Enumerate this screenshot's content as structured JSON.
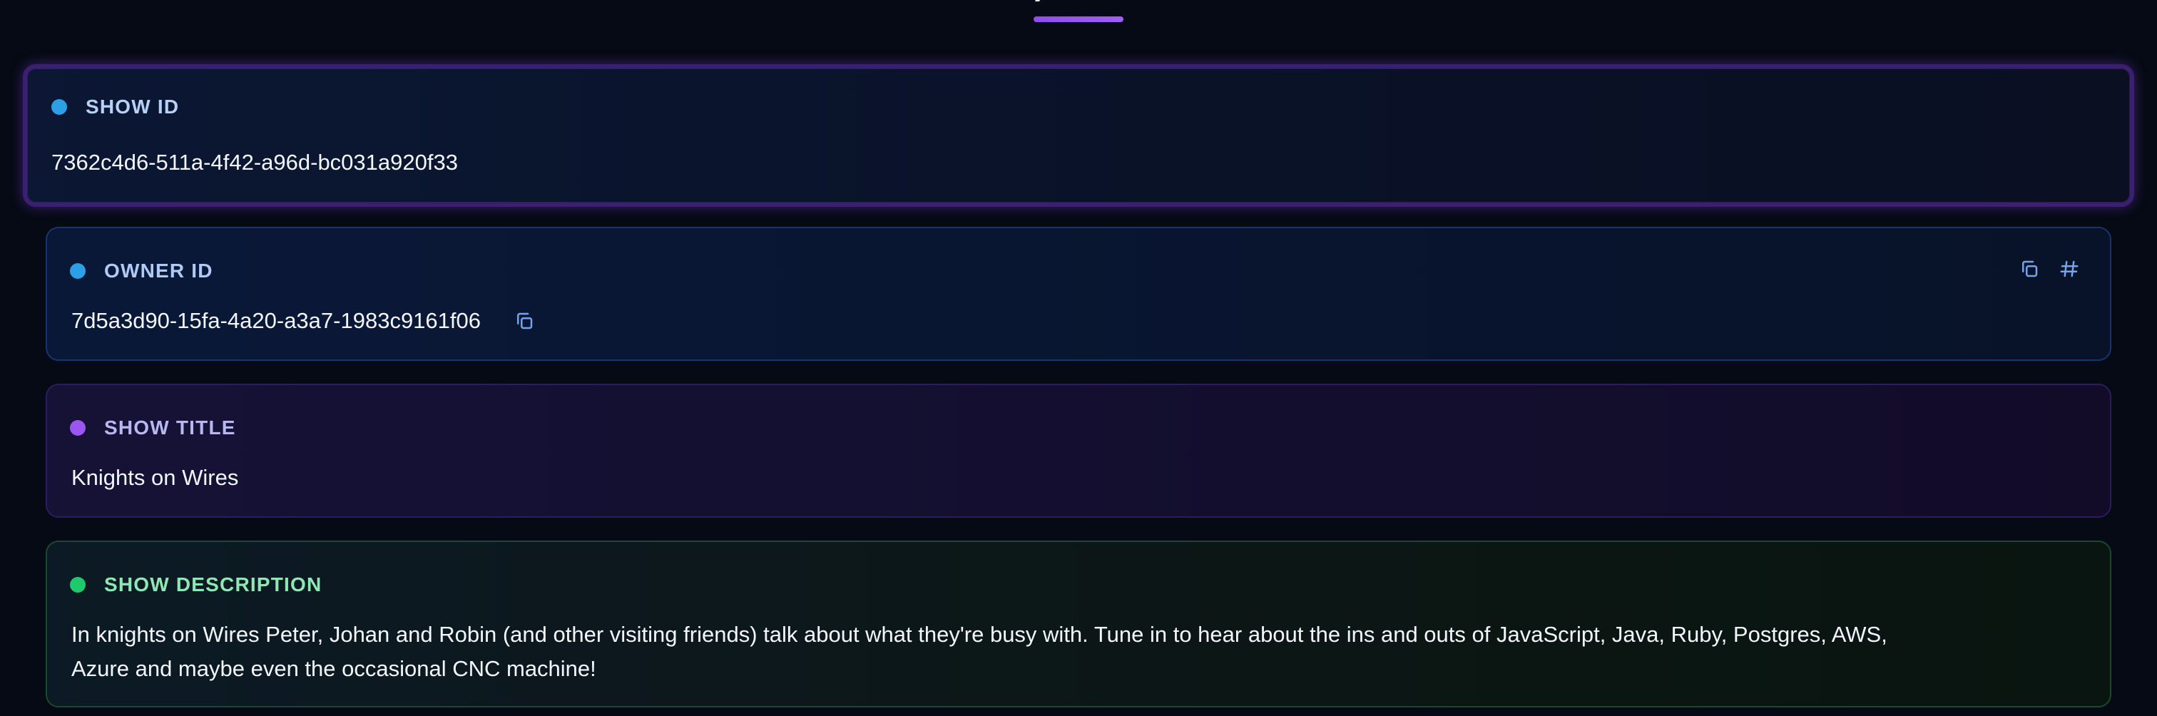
{
  "header": {
    "active_tab_label": ")"
  },
  "cards": {
    "show_id": {
      "label": "SHOW ID",
      "value": "7362c4d6-511a-4f42-a96d-bc031a920f33"
    },
    "owner_id": {
      "label": "OWNER ID",
      "value": "7d5a3d90-15fa-4a20-a3a7-1983c9161f06",
      "copy_icon": "copy-icon",
      "hash_icon": "hash-icon"
    },
    "show_title": {
      "label": "SHOW TITLE",
      "value": "Knights on Wires"
    },
    "show_description": {
      "label": "SHOW DESCRIPTION",
      "value": "In knights on Wires Peter, Johan and Robin (and other visiting friends) talk about what they're busy with. Tune in to hear about the ins and outs of JavaScript, Java, Ruby, Postgres, AWS,\nAzure and maybe even the occasional CNC machine!"
    }
  },
  "colors": {
    "background": "#060a14",
    "accent_purple": "#8f4cf2",
    "blue_dot": "#2c9fe6",
    "purple_dot": "#9b56f1",
    "green_dot": "#1fca6c"
  }
}
